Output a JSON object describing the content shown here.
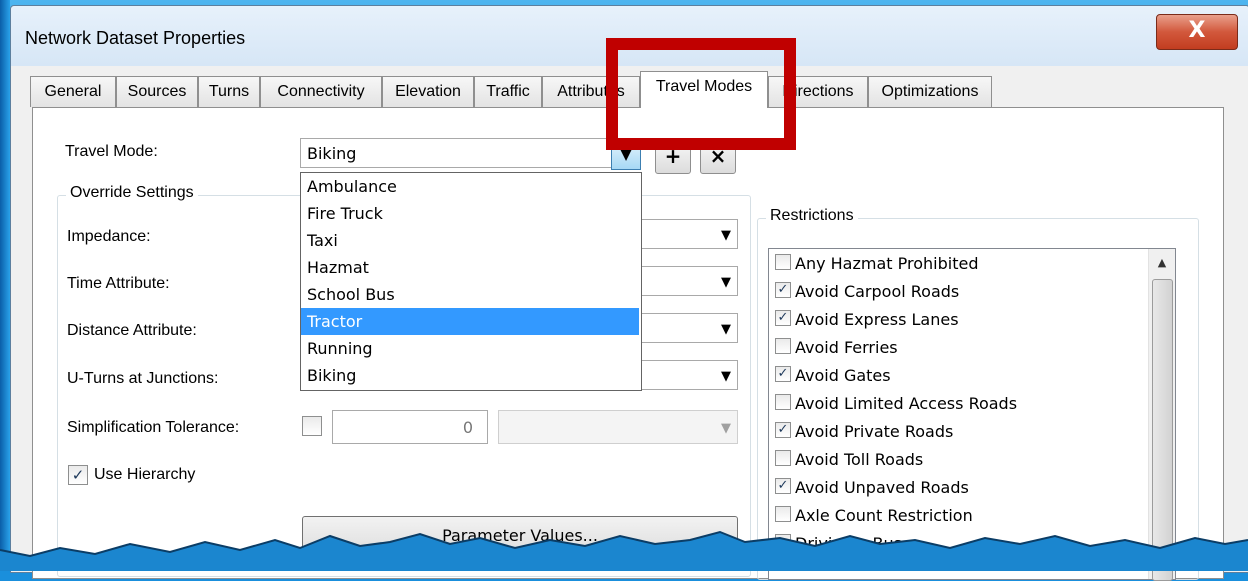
{
  "window": {
    "title": "Network Dataset Properties",
    "close_glyph": "X"
  },
  "tabs": [
    {
      "label": "General"
    },
    {
      "label": "Sources"
    },
    {
      "label": "Turns"
    },
    {
      "label": "Connectivity"
    },
    {
      "label": "Elevation"
    },
    {
      "label": "Traffic"
    },
    {
      "label": "Attributes"
    },
    {
      "label": "Travel Modes",
      "active": true
    },
    {
      "label": "Directions"
    },
    {
      "label": "Optimizations"
    }
  ],
  "travel_mode": {
    "label": "Travel Mode:",
    "value": "Biking",
    "options": [
      "Ambulance",
      "Fire Truck",
      "Taxi",
      "Hazmat",
      "School Bus",
      "Tractor",
      "Running",
      "Biking"
    ],
    "highlighted_option": "Tractor",
    "add_glyph": "+",
    "remove_glyph": "×"
  },
  "override": {
    "title": "Override Settings",
    "impedance_label": "Impedance:",
    "time_label": "Time Attribute:",
    "distance_label": "Distance Attribute:",
    "uturns_label": "U-Turns at Junctions:",
    "simplification_label": "Simplification Tolerance:",
    "simplification_checked": false,
    "simplification_value": "0",
    "hierarchy_label": "Use Hierarchy",
    "hierarchy_checked": true,
    "param_button": "Parameter Values..."
  },
  "restrictions": {
    "title": "Restrictions",
    "items": [
      {
        "label": "Any Hazmat Prohibited",
        "checked": false
      },
      {
        "label": "Avoid Carpool Roads",
        "checked": true
      },
      {
        "label": "Avoid Express Lanes",
        "checked": true
      },
      {
        "label": "Avoid Ferries",
        "checked": false
      },
      {
        "label": "Avoid Gates",
        "checked": true
      },
      {
        "label": "Avoid Limited Access Roads",
        "checked": false
      },
      {
        "label": "Avoid Private Roads",
        "checked": true
      },
      {
        "label": "Avoid Toll Roads",
        "checked": false
      },
      {
        "label": "Avoid Unpaved Roads",
        "checked": true
      },
      {
        "label": "Axle Count Restriction",
        "checked": false
      },
      {
        "label": "Driving a Bus",
        "checked": false
      }
    ]
  },
  "colors": {
    "highlight_box": "#c00000",
    "selection": "#3399ff"
  }
}
